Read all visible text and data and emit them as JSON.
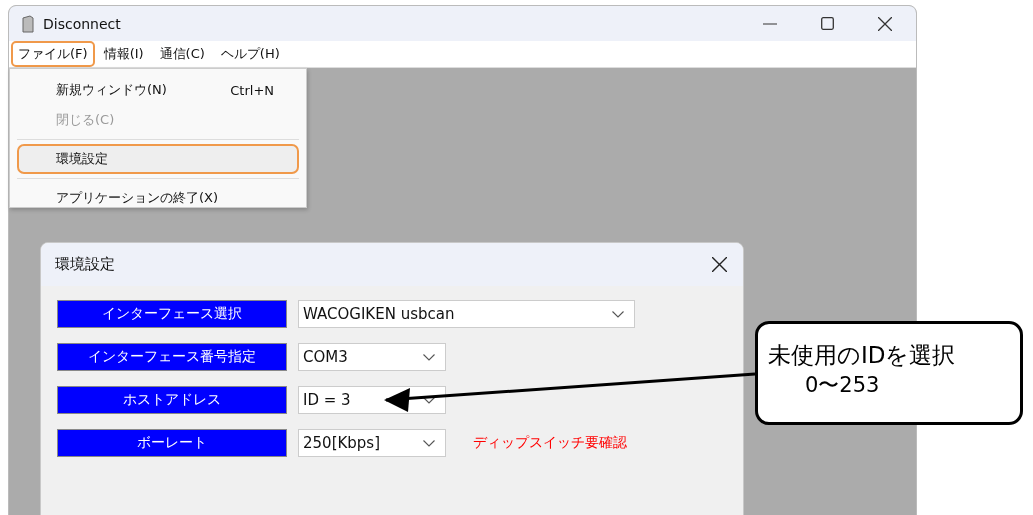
{
  "window": {
    "title": "Disconnect"
  },
  "menu_bar": [
    {
      "label": "ファイル(F)",
      "selected": true
    },
    {
      "label": "情報(I)",
      "selected": false
    },
    {
      "label": "通信(C)",
      "selected": false
    },
    {
      "label": "ヘルプ(H)",
      "selected": false
    }
  ],
  "file_menu": {
    "items": [
      {
        "kind": "item",
        "label": "新規ウィンドウ(N)",
        "shortcut": "Ctrl+N",
        "disabled": false,
        "highlighted": false
      },
      {
        "kind": "item",
        "label": "閉じる(C)",
        "disabled": true,
        "highlighted": false
      },
      {
        "kind": "separator"
      },
      {
        "kind": "item",
        "label": "環境設定",
        "disabled": false,
        "highlighted": true
      },
      {
        "kind": "separator"
      },
      {
        "kind": "item",
        "label": "アプリケーションの終了(X)",
        "disabled": false,
        "highlighted": false
      }
    ]
  },
  "dialog": {
    "title": "環境設定",
    "rows": [
      {
        "label": "インターフェース選択",
        "value": "WACOGIKEN usbcan",
        "wide": true
      },
      {
        "label": "インターフェース番号指定",
        "value": "COM3",
        "wide": false
      },
      {
        "label": "ホストアドレス",
        "value": "ID = 3",
        "wide": false
      },
      {
        "label": "ボーレート",
        "value": "250[Kbps]",
        "wide": false,
        "note": "ディップスイッチ要確認"
      }
    ]
  },
  "callout": {
    "text": "未使用のIDを選択",
    "subtext": "0〜253"
  }
}
